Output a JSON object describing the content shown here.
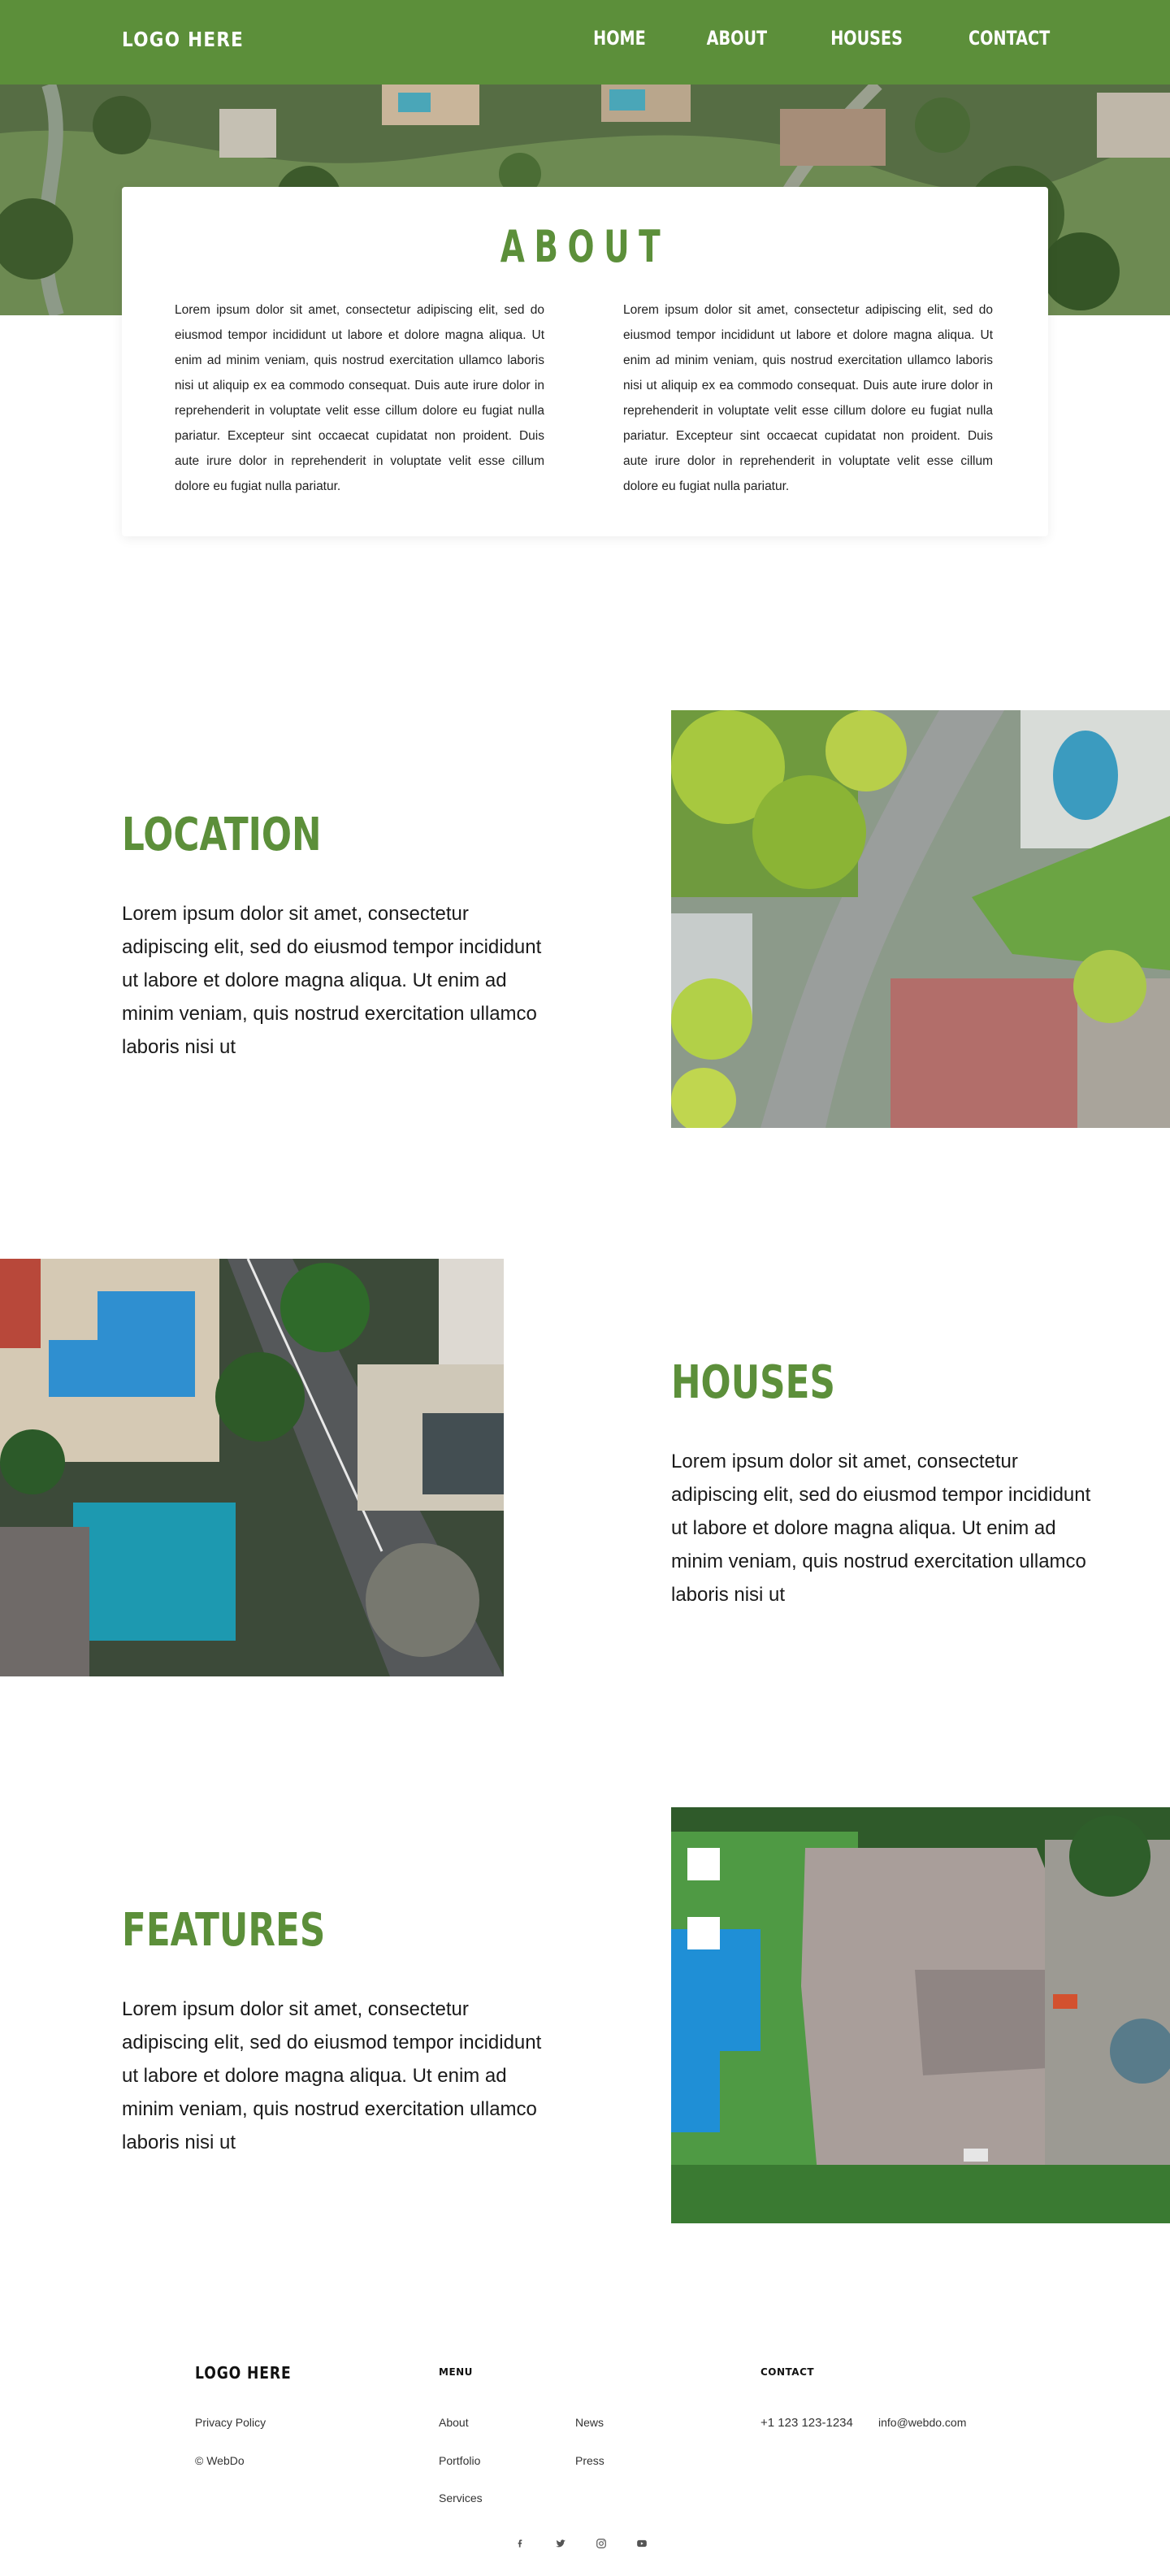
{
  "header": {
    "logo": "LOGO HERE",
    "nav": [
      "HOME",
      "ABOUT",
      "HOUSES",
      "CONTACT"
    ]
  },
  "about": {
    "title": "ABOUT",
    "col1": "Lorem ipsum dolor sit amet, consectetur adipiscing elit, sed do eiusmod tempor incididunt ut labore et dolore magna aliqua. Ut enim ad minim veniam, quis nostrud exercitation ullamco laboris nisi ut aliquip ex ea commodo consequat. Duis aute irure dolor in reprehenderit in voluptate velit esse cillum dolore eu fugiat nulla pariatur. Excepteur sint occaecat cupidatat non proident. Duis aute irure dolor in reprehenderit in voluptate velit esse cillum dolore eu fugiat nulla pariatur.",
    "col2": "Lorem ipsum dolor sit amet, consectetur adipiscing elit, sed do eiusmod tempor incididunt ut labore et dolore magna aliqua. Ut enim ad minim veniam, quis nostrud exercitation ullamco laboris nisi ut aliquip ex ea commodo consequat. Duis aute irure dolor in reprehenderit in voluptate velit esse cillum dolore eu fugiat nulla pariatur. Excepteur sint occaecat cupidatat non proident. Duis aute irure dolor in reprehenderit in voluptate velit esse cillum dolore eu fugiat nulla pariatur."
  },
  "sections": [
    {
      "title": "LOCATION",
      "text": "Lorem ipsum dolor sit amet, consectetur adipiscing elit, sed do eiusmod tempor incididunt ut labore et dolore magna aliqua. Ut enim ad minim veniam, quis nostrud exercitation ullamco laboris nisi ut"
    },
    {
      "title": "HOUSES",
      "text": "Lorem ipsum dolor sit amet, consectetur adipiscing elit, sed do eiusmod tempor incididunt ut labore et dolore magna aliqua. Ut enim ad minim veniam, quis nostrud exercitation ullamco laboris nisi ut"
    },
    {
      "title": "FEATURES",
      "text": "Lorem ipsum dolor sit amet, consectetur adipiscing elit, sed do eiusmod tempor incididunt ut labore et dolore magna aliqua. Ut enim ad minim veniam, quis nostrud exercitation ullamco laboris nisi ut"
    }
  ],
  "footer": {
    "logo": "LOGO HERE",
    "privacy": "Privacy Policy",
    "copyright": "© WebDo",
    "menu_heading": "MENU",
    "menu_col1": [
      "About",
      "Portfolio",
      "Services"
    ],
    "menu_col2": [
      "News",
      "Press"
    ],
    "contact_heading": "CONTACT",
    "phone": "+1 123 123-1234",
    "email": "info@webdo.com",
    "socials": [
      "facebook-icon",
      "twitter-icon",
      "instagram-icon",
      "youtube-icon"
    ]
  },
  "colors": {
    "accent": "#5c8f3a"
  }
}
